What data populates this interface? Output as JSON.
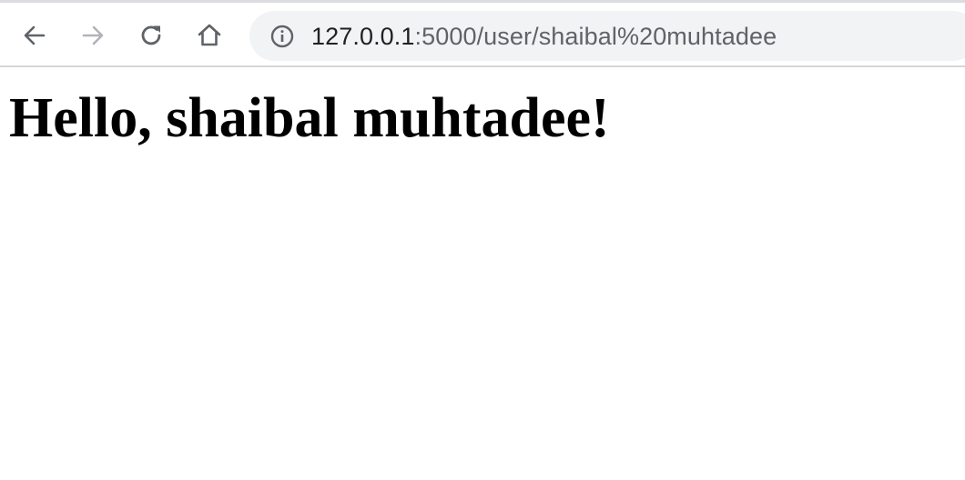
{
  "browser": {
    "toolbar": {
      "back_icon": "arrow-left",
      "forward_icon": "arrow-right",
      "reload_icon": "reload",
      "home_icon": "home",
      "forward_enabled": false
    },
    "omnibox": {
      "site_info_icon": "info-circle",
      "url_host": "127.0.0.1",
      "url_rest": ":5000/user/shaibal%20muhtadee"
    }
  },
  "page": {
    "heading": "Hello, shaibal muhtadee!"
  },
  "colors": {
    "toolbar_icon": "#5f6368",
    "disabled_icon": "#b0b3b8",
    "omnibox_bg": "#f1f3f4",
    "url_host": "#202124",
    "url_rest": "#5f6368",
    "heading": "#000000"
  }
}
